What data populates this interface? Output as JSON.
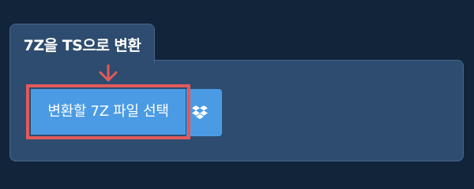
{
  "converter": {
    "tab_title": "7Z을 TS으로 변환",
    "choose_file_label": "변환할 7Z 파일 선택",
    "dropbox_icon": "dropbox-icon",
    "arrow_icon": "arrow-down-icon"
  },
  "colors": {
    "page_background": "#12243a",
    "panel_background": "#2d4c6f",
    "button_background": "#4b9be4",
    "highlight_border": "#e15a5a"
  }
}
